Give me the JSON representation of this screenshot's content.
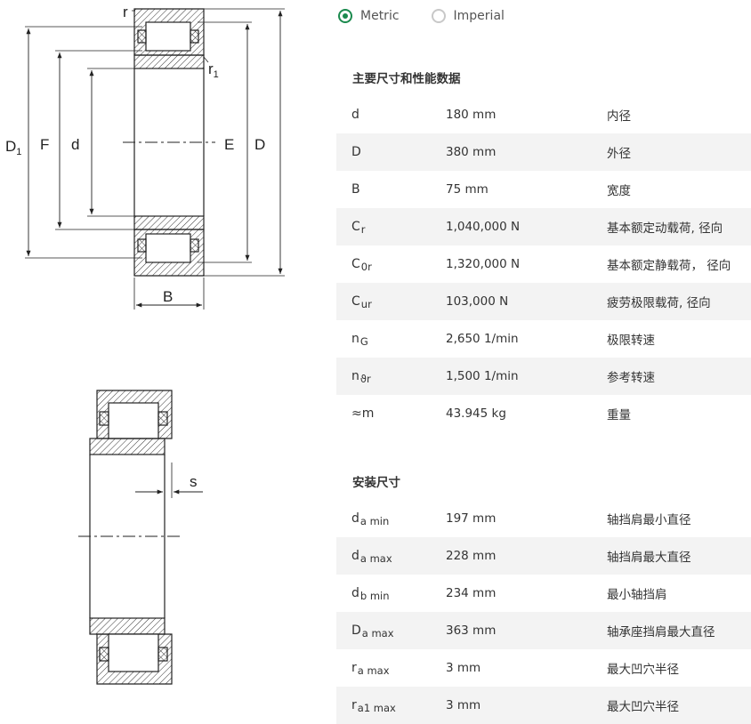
{
  "units": {
    "options": [
      {
        "label": "Metric",
        "selected": true
      },
      {
        "label": "Imperial",
        "selected": false
      }
    ]
  },
  "drawing_labels": {
    "r": "r",
    "r1_base": "r",
    "r1_sub": "1",
    "D1_base": "D",
    "D1_sub": "1",
    "F": "F",
    "d": "d",
    "E": "E",
    "D": "D",
    "B": "B",
    "s": "s"
  },
  "sections": [
    {
      "title": "主要尺寸和性能数据",
      "rows": [
        {
          "sym": "d",
          "sub": "",
          "value": "180 mm",
          "desc": "内径"
        },
        {
          "sym": "D",
          "sub": "",
          "value": "380 mm",
          "desc": "外径"
        },
        {
          "sym": "B",
          "sub": "",
          "value": "75 mm",
          "desc": "宽度"
        },
        {
          "sym": "C",
          "sub": "r",
          "value": "1,040,000 N",
          "desc": "基本额定动载荷, 径向"
        },
        {
          "sym": "C",
          "sub": "0r",
          "value": "1,320,000 N",
          "desc": "基本额定静载荷， 径向"
        },
        {
          "sym": "C",
          "sub": "ur",
          "value": "103,000 N",
          "desc": "疲劳极限载荷, 径向"
        },
        {
          "sym": "n",
          "sub": "G",
          "value": "2,650 1/min",
          "desc": "极限转速"
        },
        {
          "sym": "n",
          "sub": "ϑr",
          "value": "1,500 1/min",
          "desc": "参考转速"
        },
        {
          "sym": "≈m",
          "sub": "",
          "value": "43.945 kg",
          "desc": "重量"
        }
      ]
    },
    {
      "title": "安装尺寸",
      "rows": [
        {
          "sym": "d",
          "sub": "a min",
          "value": "197 mm",
          "desc": "轴挡肩最小直径"
        },
        {
          "sym": "d",
          "sub": "a max",
          "value": "228 mm",
          "desc": "轴挡肩最大直径"
        },
        {
          "sym": "d",
          "sub": "b min",
          "value": "234 mm",
          "desc": "最小轴挡肩"
        },
        {
          "sym": "D",
          "sub": "a max",
          "value": "363 mm",
          "desc": "轴承座挡肩最大直径"
        },
        {
          "sym": "r",
          "sub": "a max",
          "value": "3 mm",
          "desc": "最大凹穴半径"
        },
        {
          "sym": "r",
          "sub": "a1 max",
          "value": "3 mm",
          "desc": "最大凹穴半径"
        }
      ]
    }
  ],
  "colors": {
    "accent": "#1b8a4e",
    "row_alt": "#f3f3f3"
  }
}
